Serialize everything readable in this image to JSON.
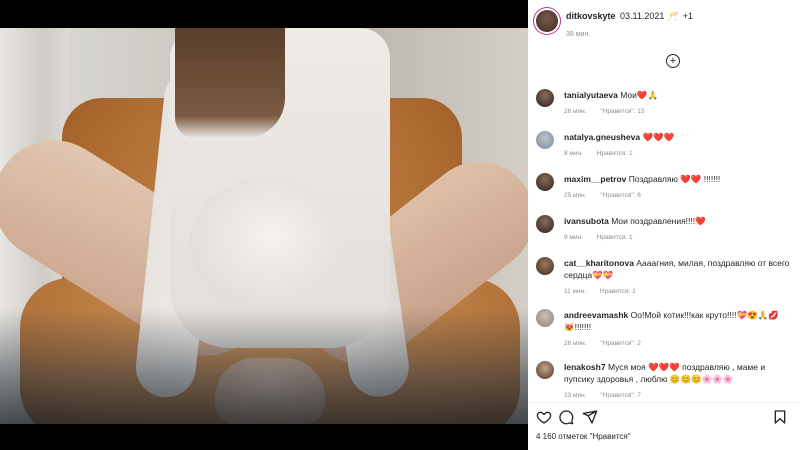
{
  "post": {
    "author": "ditkovskyte",
    "date": "03.11.2021",
    "extra_emoji": "🥂",
    "plus_count": "+1",
    "time_ago": "38 мин."
  },
  "comments": [
    {
      "user": "tanialyutaeva",
      "text": "Мои❤️🙏",
      "time": "26 мин.",
      "likes": "\"Нравится\": 15"
    },
    {
      "user": "natalya.gneusheva",
      "text": "❤️❤️❤️",
      "time": "8 мин.",
      "likes": "Нравится: 1"
    },
    {
      "user": "maxim__petrov",
      "text": "Поздравляю ❤️❤️ !!!!!!!",
      "time": "25 мин.",
      "likes": "\"Нравится\": 6"
    },
    {
      "user": "ivansubota",
      "text": "Мои поздравления!!!!❤️",
      "time": "9 мин.",
      "likes": "Нравится: 1"
    },
    {
      "user": "cat__kharitonova",
      "text": "Аааагния, милая, поздравляю от всего сердца💝💝",
      "time": "11 мин.",
      "likes": "Нравится: 1"
    },
    {
      "user": "andreevamashk",
      "text": "Оо!Мой котик!!!как круто!!!!💝😍🙏💋😻!!!!!!!",
      "time": "26 мин.",
      "likes": "\"Нравится\": 2"
    },
    {
      "user": "lenakosh7",
      "text": "Муся моя ❤️❤️❤️ поздравляю , маме и пупсику здоровья , люблю 😊😊😊🌸🌸🌸",
      "time": "23 мин.",
      "likes": "\"Нравится\": 7"
    }
  ],
  "footer": {
    "likes_text": "4 160 отметок \"Нравится\""
  },
  "icons": [
    "heart-icon",
    "comment-icon",
    "share-icon",
    "bookmark-icon",
    "add-icon"
  ],
  "colors": {
    "like_red": "#ed4956",
    "muted": "#8e8e8e",
    "text": "#262626"
  }
}
